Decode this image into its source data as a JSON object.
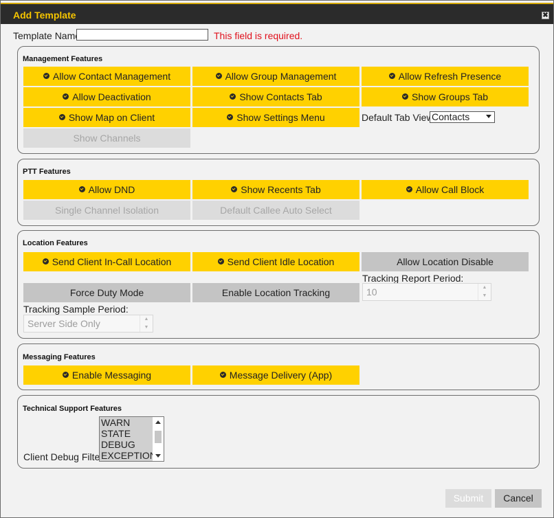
{
  "dialog": {
    "title": "Add Template",
    "close_glyph": "✖"
  },
  "template_name": {
    "label": "Template Name:",
    "value": "",
    "placeholder": "",
    "error": "This field is required."
  },
  "management": {
    "title": "Management Features",
    "buttons": [
      "Allow Contact Management",
      "Allow Group Management",
      "Allow Refresh Presence",
      "Allow Deactivation",
      "Show Contacts Tab",
      "Show Groups Tab",
      "Show Map on Client",
      "Show Settings Menu"
    ],
    "show_channels": "Show Channels",
    "default_tab_label": "Default Tab View:",
    "default_tab_value": "Contacts"
  },
  "ptt": {
    "title": "PTT Features",
    "buttons": [
      "Allow DND",
      "Show Recents Tab",
      "Allow Call Block"
    ],
    "disabled_buttons": [
      "Single Channel Isolation",
      "Default Callee Auto Select"
    ]
  },
  "location": {
    "title": "Location Features",
    "buttons": [
      "Send Client In-Call Location",
      "Send Client Idle Location"
    ],
    "gray_buttons": [
      "Allow Location Disable",
      "Force Duty Mode",
      "Enable Location Tracking"
    ],
    "report_period_label": "Tracking Report Period:",
    "report_period_value": "10",
    "sample_period_label": "Tracking Sample Period:",
    "sample_period_value": "Server Side Only"
  },
  "messaging": {
    "title": "Messaging Features",
    "buttons": [
      "Enable Messaging",
      "Message Delivery (App)"
    ]
  },
  "tech_support": {
    "title": "Technical Support Features",
    "debug_label": "Client Debug Filter:",
    "debug_options": [
      "WARN",
      "STATE",
      "DEBUG",
      "EXCEPTION"
    ]
  },
  "footer": {
    "submit": "Submit",
    "cancel": "Cancel"
  },
  "colors": {
    "accent": "#ffd100",
    "title_text": "#f5c400",
    "error": "#e0101c"
  }
}
